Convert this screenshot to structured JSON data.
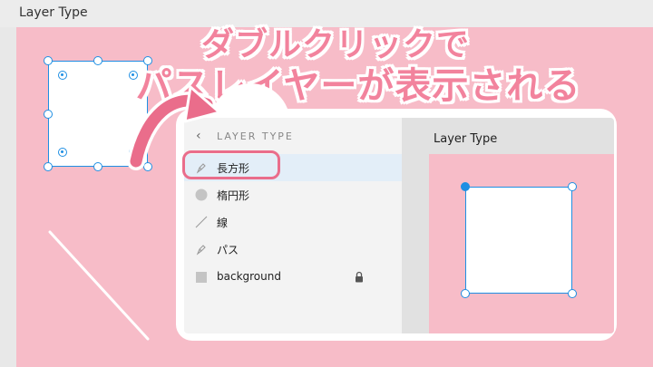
{
  "artboard": {
    "title": "Layer Type"
  },
  "headline": {
    "line1": "ダブルクリックで",
    "line2": "パスレイヤーが表示される"
  },
  "layers_panel": {
    "title": "LAYER TYPE",
    "items": [
      {
        "label": "長方形",
        "icon": "pen-icon",
        "selected": true
      },
      {
        "label": "楕円形",
        "icon": "ellipse-icon",
        "selected": false
      },
      {
        "label": "線",
        "icon": "line-icon",
        "selected": false
      },
      {
        "label": "パス",
        "icon": "pen-icon",
        "selected": false
      },
      {
        "label": "background",
        "icon": "square-icon",
        "selected": false,
        "locked": true
      }
    ]
  },
  "canvas_preview": {
    "title": "Layer Type"
  },
  "colors": {
    "accent": "#ea6d8b",
    "artboard": "#f7bcc8",
    "selection": "#1f8fe3"
  }
}
